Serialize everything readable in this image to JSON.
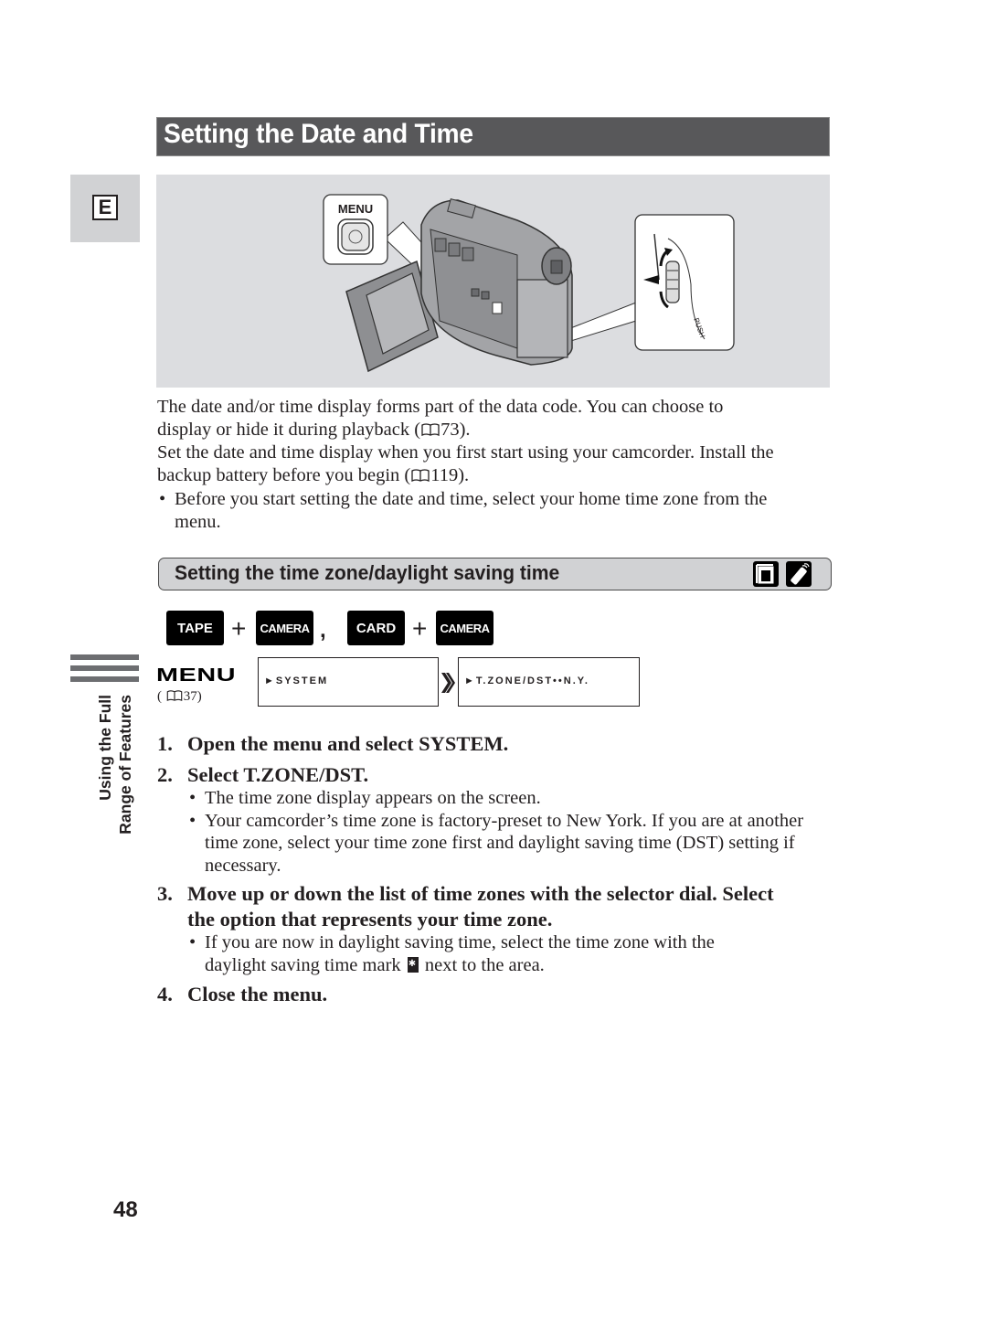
{
  "header": {
    "title": "Setting the Date and Time"
  },
  "language_tab": {
    "letter": "E"
  },
  "illustration": {
    "menu_button_label": "MENU",
    "dial_label": "PUSH"
  },
  "intro": {
    "p1": [
      "The date and/or time display forms part of the data code. You can choose to",
      "display or hide it during playback (",
      "73)."
    ],
    "p2": [
      "Set the date and time display when you first start using your camcorder. Install the",
      "backup battery before you begin (",
      "119)."
    ],
    "bullet": [
      "Before you start setting the date and time, select your home time zone from the",
      "menu."
    ]
  },
  "subsection": {
    "title": "Setting the time zone/daylight saving time",
    "icons": [
      "card-icon",
      "remote-control-icon"
    ]
  },
  "modes": {
    "group1": [
      "TAPE",
      "CAMERA"
    ],
    "group2": [
      "CARD",
      "CAMERA"
    ],
    "plus": "+",
    "separator": ","
  },
  "menu_path": {
    "logo": "MENU",
    "ref_open": "(",
    "ref_page": "37)",
    "screen1": "►SYSTEM",
    "screen2": "►T.ZONE/DST••N.Y."
  },
  "side_tab": {
    "line1": "Using the Full",
    "line2": "Range of Features"
  },
  "steps": [
    {
      "num": "1.",
      "text": "Open the menu and select SYSTEM."
    },
    {
      "num": "2.",
      "text": "Select T.ZONE/DST.",
      "bullets": [
        "The time zone display appears on the screen.",
        "Your camcorder’s time zone is factory-preset to New York. If you are at another time zone, select your time zone first and daylight saving time (DST) setting if necessary."
      ]
    },
    {
      "num": "3.",
      "text": "Move up or down the list of time zones with the selector dial. Select the option that represents your time zone.",
      "bullets": [
        "If you are now in daylight saving time, select the time zone with the daylight saving time mark",
        "next to the area."
      ]
    },
    {
      "num": "4.",
      "text": "Close the menu."
    }
  ],
  "page_number": "48"
}
